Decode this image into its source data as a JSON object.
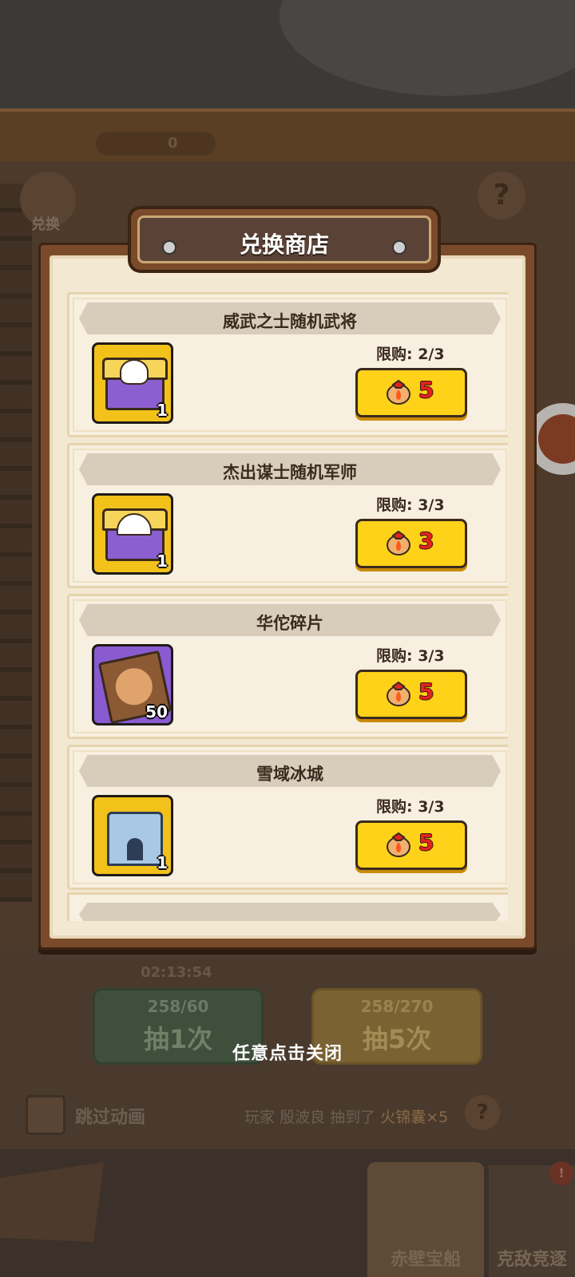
{
  "background": {
    "counter_value": "0",
    "exchange_label": "兑换",
    "help_label": "?",
    "timer": "02:13:54",
    "draw_one": {
      "cost": "258/60",
      "label": "抽1次"
    },
    "draw_five": {
      "cost": "258/270",
      "label": "抽5次"
    },
    "skip_animation": "跳过动画",
    "news": {
      "prefix": "玩家",
      "player": "殷波良",
      "action": "抽到了",
      "item": "火锦囊×5"
    },
    "nav": [
      "赤壁宝船",
      "克敌竞逐"
    ],
    "badge": "!"
  },
  "modal": {
    "title": "兑换商店",
    "items": [
      {
        "name": "威武之士随机武将",
        "limit": "限购: 2/3",
        "price": "5",
        "qty": "1",
        "icon": "gold-chest-icon"
      },
      {
        "name": "杰出谋士随机军师",
        "limit": "限购: 3/3",
        "price": "3",
        "qty": "1",
        "icon": "gold-chest-fan-icon"
      },
      {
        "name": "华佗碎片",
        "limit": "限购: 3/3",
        "price": "5",
        "qty": "50",
        "icon": "hero-fragment-icon"
      },
      {
        "name": "雪域冰城",
        "limit": "限购: 3/3",
        "price": "5",
        "qty": "1",
        "icon": "ice-castle-icon"
      }
    ]
  },
  "close_hint": "任意点击关闭",
  "colors": {
    "price_button": "#ffd21a",
    "price_text": "#e0231e",
    "paper": "#f3e8d2",
    "frame": "#7a4b2a"
  }
}
